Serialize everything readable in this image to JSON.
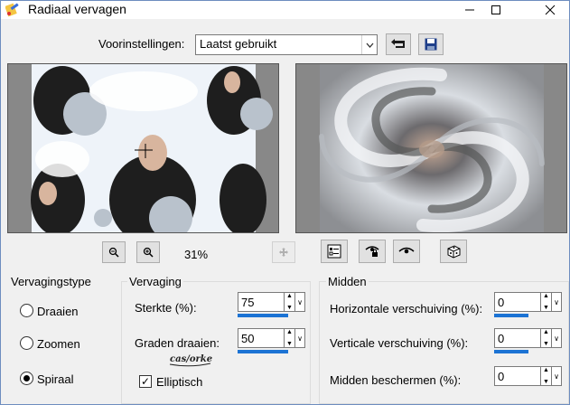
{
  "window": {
    "title": "Radiaal vervagen"
  },
  "presets": {
    "label": "Voorinstellingen:",
    "value": "Laatst gebruikt"
  },
  "zoom": {
    "percent": "31%"
  },
  "blur_type": {
    "label": "Vervagingstype",
    "options": [
      "Draaien",
      "Zoomen",
      "Spiraal"
    ],
    "selected": "Spiraal"
  },
  "blur": {
    "label": "Vervaging",
    "strength_label": "Sterkte (%):",
    "strength_value": "75",
    "strength_fraction": 0.75,
    "twist_label": "Graden draaien:",
    "twist_value": "50",
    "twist_fraction": 0.75,
    "elliptical_label": "Elliptisch",
    "elliptical_checked": true,
    "watermark": "cas/orke"
  },
  "center": {
    "label": "Midden",
    "h_offset_label": "Horizontale verschuiving (%):",
    "h_offset_value": "0",
    "h_offset_fraction": 0.5,
    "v_offset_label": "Verticale verschuiving (%):",
    "v_offset_value": "0",
    "v_offset_fraction": 0.5,
    "protect_label": "Midden beschermen (%):",
    "protect_value": "0"
  },
  "colors": {
    "accent": "#1c73d4",
    "window_border": "#6d8dbf"
  }
}
